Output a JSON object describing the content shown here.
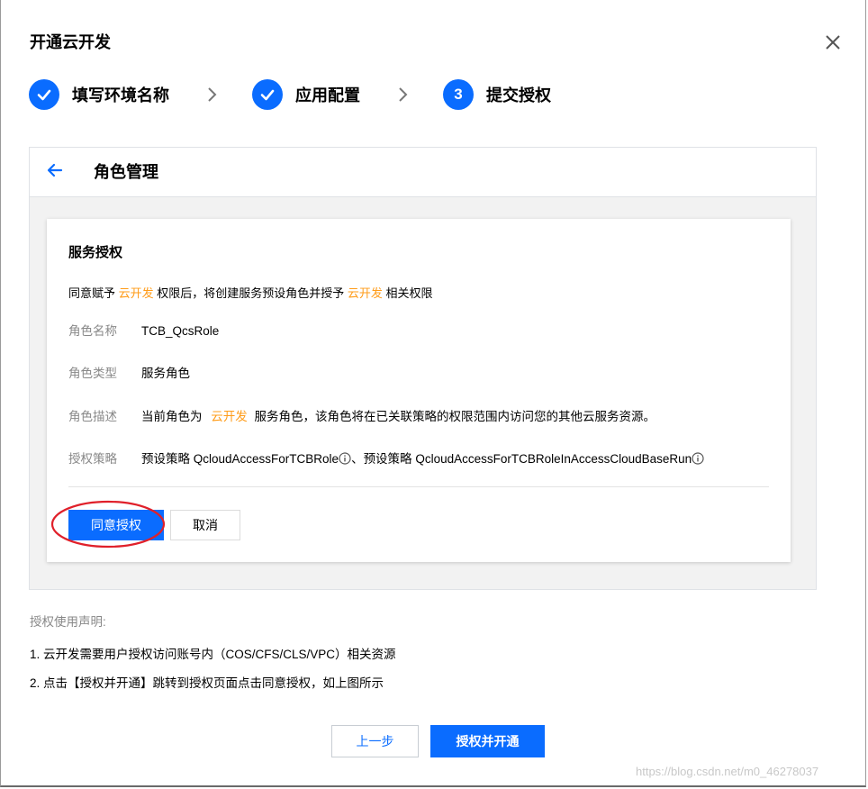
{
  "dialog": {
    "title": "开通云开发"
  },
  "steps": [
    {
      "number": "",
      "label": "填写环境名称",
      "status": "done",
      "icon": "check-icon"
    },
    {
      "number": "",
      "label": "应用配置",
      "status": "done",
      "icon": "check-icon"
    },
    {
      "number": "3",
      "label": "提交授权",
      "status": "active"
    }
  ],
  "panel": {
    "title": "角色管理",
    "back_icon": "arrow-left-icon"
  },
  "card": {
    "title": "服务授权",
    "agree": {
      "prefix": "同意赋予 ",
      "product1": "云开发",
      "middle": " 权限后，将创建服务预设角色并授予 ",
      "product2": "云开发",
      "suffix": " 相关权限"
    },
    "role_name": {
      "label": "角色名称",
      "value": "TCB_QcsRole"
    },
    "role_type": {
      "label": "角色类型",
      "value": "服务角色"
    },
    "role_desc": {
      "label": "角色描述",
      "prefix": "当前角色为 ",
      "product": "云开发",
      "suffix": " 服务角色，该角色将在已关联策略的权限范围内访问您的其他云服务资源。"
    },
    "policy": {
      "label": "授权策略",
      "part1": "预设策略 QcloudAccessForTCBRole",
      "sep": "、",
      "part2": "预设策略 QcloudAccessForTCBRoleInAccessCloudBaseRun"
    },
    "agree_button": "同意授权",
    "cancel_button": "取消"
  },
  "notes": {
    "title": "授权使用声明:",
    "items": [
      "1. 云开发需要用户授权访问账号内（COS/CFS/CLS/VPC）相关资源",
      "2. 点击【授权并开通】跳转到授权页面点击同意授权，如上图所示"
    ]
  },
  "footer": {
    "prev_button": "上一步",
    "submit_button": "授权并开通"
  },
  "watermark": "https://blog.csdn.net/m0_46278037",
  "colors": {
    "primary": "#0a6cff",
    "highlight": "#ff9c19",
    "annotation": "#e0202a"
  }
}
